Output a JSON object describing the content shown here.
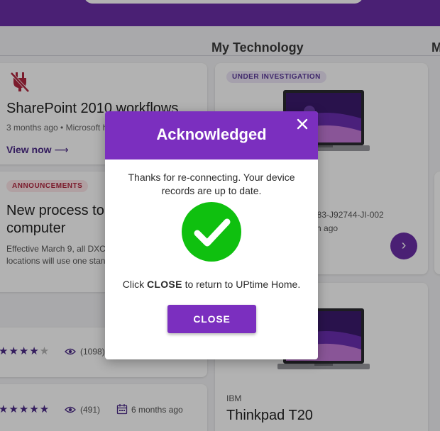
{
  "colors": {
    "brand_purple": "#7b2fbf",
    "success_green": "#0fc00f",
    "announcement_red": "#b0273f"
  },
  "sections": {
    "my_technology": "My Technology",
    "cut_off_right": "M"
  },
  "cards": {
    "sharepoint": {
      "icon": "plug-off-icon",
      "title": "SharePoint 2010 workflows",
      "meta": "3 months ago • Microsoft h",
      "link": "View now"
    },
    "announcement": {
      "badge": "ANNOUNCEMENTS",
      "title_line1": "New process to",
      "title_line2": "computer",
      "body_line1": "Effective March 9, all DXC",
      "body_line2": "locations will use one stan"
    },
    "rating1": {
      "rating": 4,
      "max": 5,
      "views": "(1098)"
    },
    "rating2": {
      "rating": 5,
      "max": 5,
      "views": "(491)",
      "date": "6 months ago"
    },
    "device1": {
      "badge": "UNDER INVESTIGATION",
      "serial": "-883-J92744-JI-002",
      "time": "nth ago"
    },
    "device2": {
      "brand": "IBM",
      "model": "Thinkpad T20"
    }
  },
  "modal": {
    "title": "Acknowledged",
    "message": "Thanks for re-connecting. Your device records are up to date.",
    "instruction_prefix": "Click",
    "instruction_bold": "CLOSE",
    "instruction_suffix": "to return to UPtime Home.",
    "close_button": "CLOSE"
  }
}
